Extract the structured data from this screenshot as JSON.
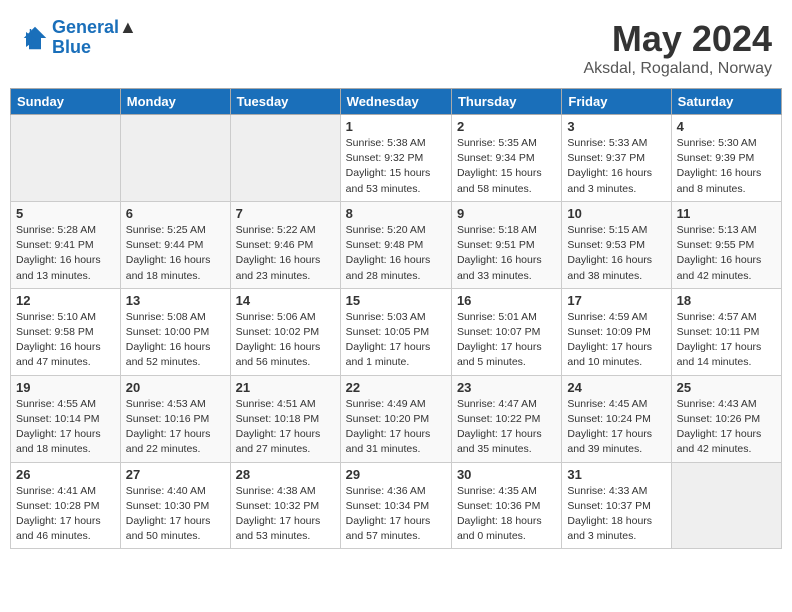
{
  "header": {
    "logo_line1": "General",
    "logo_line2": "Blue",
    "month": "May 2024",
    "location": "Aksdal, Rogaland, Norway"
  },
  "days_of_week": [
    "Sunday",
    "Monday",
    "Tuesday",
    "Wednesday",
    "Thursday",
    "Friday",
    "Saturday"
  ],
  "weeks": [
    [
      {
        "day": "",
        "empty": true
      },
      {
        "day": "",
        "empty": true
      },
      {
        "day": "",
        "empty": true
      },
      {
        "day": "1",
        "sunrise": "5:38 AM",
        "sunset": "9:32 PM",
        "daylight": "15 hours and 53 minutes."
      },
      {
        "day": "2",
        "sunrise": "5:35 AM",
        "sunset": "9:34 PM",
        "daylight": "15 hours and 58 minutes."
      },
      {
        "day": "3",
        "sunrise": "5:33 AM",
        "sunset": "9:37 PM",
        "daylight": "16 hours and 3 minutes."
      },
      {
        "day": "4",
        "sunrise": "5:30 AM",
        "sunset": "9:39 PM",
        "daylight": "16 hours and 8 minutes."
      }
    ],
    [
      {
        "day": "5",
        "sunrise": "5:28 AM",
        "sunset": "9:41 PM",
        "daylight": "16 hours and 13 minutes."
      },
      {
        "day": "6",
        "sunrise": "5:25 AM",
        "sunset": "9:44 PM",
        "daylight": "16 hours and 18 minutes."
      },
      {
        "day": "7",
        "sunrise": "5:22 AM",
        "sunset": "9:46 PM",
        "daylight": "16 hours and 23 minutes."
      },
      {
        "day": "8",
        "sunrise": "5:20 AM",
        "sunset": "9:48 PM",
        "daylight": "16 hours and 28 minutes."
      },
      {
        "day": "9",
        "sunrise": "5:18 AM",
        "sunset": "9:51 PM",
        "daylight": "16 hours and 33 minutes."
      },
      {
        "day": "10",
        "sunrise": "5:15 AM",
        "sunset": "9:53 PM",
        "daylight": "16 hours and 38 minutes."
      },
      {
        "day": "11",
        "sunrise": "5:13 AM",
        "sunset": "9:55 PM",
        "daylight": "16 hours and 42 minutes."
      }
    ],
    [
      {
        "day": "12",
        "sunrise": "5:10 AM",
        "sunset": "9:58 PM",
        "daylight": "16 hours and 47 minutes."
      },
      {
        "day": "13",
        "sunrise": "5:08 AM",
        "sunset": "10:00 PM",
        "daylight": "16 hours and 52 minutes."
      },
      {
        "day": "14",
        "sunrise": "5:06 AM",
        "sunset": "10:02 PM",
        "daylight": "16 hours and 56 minutes."
      },
      {
        "day": "15",
        "sunrise": "5:03 AM",
        "sunset": "10:05 PM",
        "daylight": "17 hours and 1 minute."
      },
      {
        "day": "16",
        "sunrise": "5:01 AM",
        "sunset": "10:07 PM",
        "daylight": "17 hours and 5 minutes."
      },
      {
        "day": "17",
        "sunrise": "4:59 AM",
        "sunset": "10:09 PM",
        "daylight": "17 hours and 10 minutes."
      },
      {
        "day": "18",
        "sunrise": "4:57 AM",
        "sunset": "10:11 PM",
        "daylight": "17 hours and 14 minutes."
      }
    ],
    [
      {
        "day": "19",
        "sunrise": "4:55 AM",
        "sunset": "10:14 PM",
        "daylight": "17 hours and 18 minutes."
      },
      {
        "day": "20",
        "sunrise": "4:53 AM",
        "sunset": "10:16 PM",
        "daylight": "17 hours and 22 minutes."
      },
      {
        "day": "21",
        "sunrise": "4:51 AM",
        "sunset": "10:18 PM",
        "daylight": "17 hours and 27 minutes."
      },
      {
        "day": "22",
        "sunrise": "4:49 AM",
        "sunset": "10:20 PM",
        "daylight": "17 hours and 31 minutes."
      },
      {
        "day": "23",
        "sunrise": "4:47 AM",
        "sunset": "10:22 PM",
        "daylight": "17 hours and 35 minutes."
      },
      {
        "day": "24",
        "sunrise": "4:45 AM",
        "sunset": "10:24 PM",
        "daylight": "17 hours and 39 minutes."
      },
      {
        "day": "25",
        "sunrise": "4:43 AM",
        "sunset": "10:26 PM",
        "daylight": "17 hours and 42 minutes."
      }
    ],
    [
      {
        "day": "26",
        "sunrise": "4:41 AM",
        "sunset": "10:28 PM",
        "daylight": "17 hours and 46 minutes."
      },
      {
        "day": "27",
        "sunrise": "4:40 AM",
        "sunset": "10:30 PM",
        "daylight": "17 hours and 50 minutes."
      },
      {
        "day": "28",
        "sunrise": "4:38 AM",
        "sunset": "10:32 PM",
        "daylight": "17 hours and 53 minutes."
      },
      {
        "day": "29",
        "sunrise": "4:36 AM",
        "sunset": "10:34 PM",
        "daylight": "17 hours and 57 minutes."
      },
      {
        "day": "30",
        "sunrise": "4:35 AM",
        "sunset": "10:36 PM",
        "daylight": "18 hours and 0 minutes."
      },
      {
        "day": "31",
        "sunrise": "4:33 AM",
        "sunset": "10:37 PM",
        "daylight": "18 hours and 3 minutes."
      },
      {
        "day": "",
        "empty": true
      }
    ]
  ],
  "labels": {
    "sunrise": "Sunrise:",
    "sunset": "Sunset:",
    "daylight": "Daylight:"
  }
}
